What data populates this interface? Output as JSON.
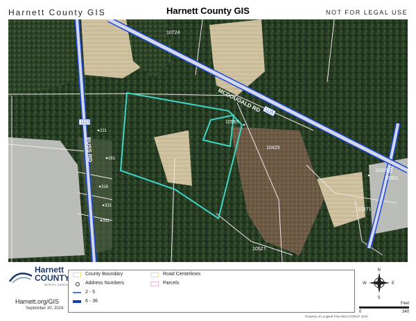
{
  "header": {
    "org_label": "Harnett County GIS",
    "title": "Harnett County GIS",
    "disclaimer": "NOT FOR LEGAL USE"
  },
  "map": {
    "road_labels": {
      "main_road": "MCDOUGALD RD",
      "main_road_shield": "1125",
      "west_road": "BUSS RD",
      "west_road_shield": "1122",
      "east_road": "DR"
    },
    "parcel_numbers": [
      "10724",
      "10565",
      "10425",
      "10371",
      "10527",
      "10325",
      "10301"
    ],
    "address_numbers": [
      "221",
      "261",
      "316",
      "331",
      "351"
    ],
    "colors": {
      "subject_outline": "#3fd6c6",
      "parcel_line": "#f2e6ea",
      "road_casing": "#1f49d8",
      "road_fill": "#d4d8e8"
    }
  },
  "logo": {
    "name_line1": "Harnett",
    "name_line2": "COUNTY",
    "tagline": "NORTH CAROLINA"
  },
  "website": "Harnett.org/GIS",
  "date": "September 30, 2024",
  "legend": {
    "items": [
      {
        "label": "County Boundary",
        "color": "#f7e25a"
      },
      {
        "label": "Address Numbers",
        "symbol": "dot"
      },
      {
        "label": "2 - 5",
        "color": "#4a7bd9"
      },
      {
        "label": "6 - 36",
        "color": "#1a3fb0"
      },
      {
        "label": "Road Centerlines",
        "color": "#f0dc9c"
      },
      {
        "label": "Parcels",
        "color": "#e8b8c8"
      }
    ]
  },
  "compass": {
    "n": "N",
    "s": "S",
    "e": "E",
    "w": "W"
  },
  "scale": {
    "unit": "Feet",
    "start": "0",
    "end": "340"
  },
  "credit": "Property of Longleaf Pine REALTORS® 2024"
}
